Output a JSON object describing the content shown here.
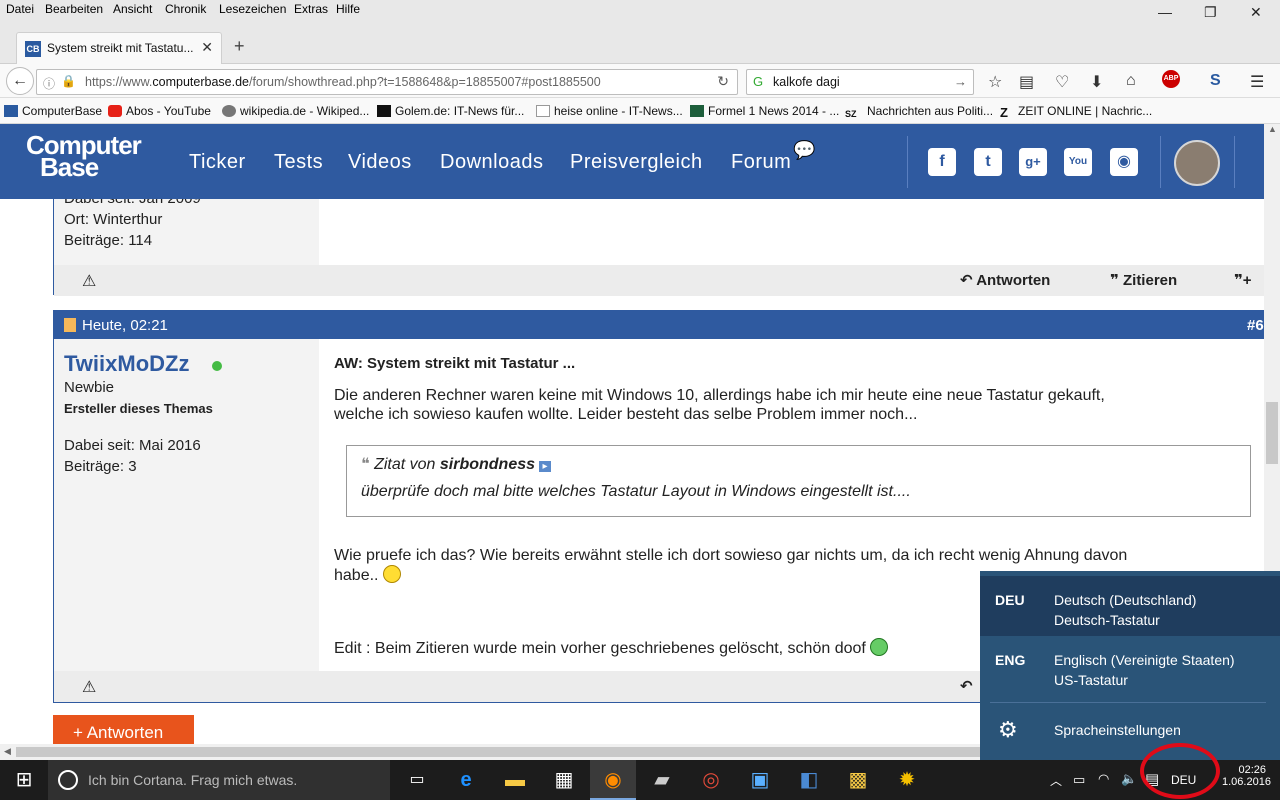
{
  "menu": [
    "Datei",
    "Bearbeiten",
    "Ansicht",
    "Chronik",
    "Lesezeichen",
    "Extras",
    "Hilfe"
  ],
  "window_controls": {
    "minimize": "—",
    "maximize": "❐",
    "close": "✕"
  },
  "tab": {
    "title": "System streikt mit Tastatu...",
    "close": "✕",
    "favicon": "CB"
  },
  "new_tab": "+",
  "address": {
    "prefix": "https://www.",
    "domain": "computerbase.de",
    "path": "/forum/showthread.php?t=1588648&p=18855007#post1885500"
  },
  "search": {
    "value": "kalkofe dagi"
  },
  "bookmarks": [
    "ComputerBase",
    "Abos - YouTube",
    "wikipedia.de - Wikiped...",
    "Golem.de: IT-News für...",
    "heise online - IT-News...",
    "Formel 1 News 2014 - ...",
    "Nachrichten aus Politi...",
    "ZEIT ONLINE | Nachric..."
  ],
  "site": {
    "logo_line1": "Computer",
    "logo_line2": "Base",
    "nav": [
      "Ticker",
      "Tests",
      "Videos",
      "Downloads",
      "Preisvergleich",
      "Forum"
    ]
  },
  "prev_post": {
    "since": "Dabei seit: Jan 2009",
    "location": "Ort: Winterthur",
    "posts": "Beiträge: 114",
    "reply": "Antworten",
    "quote": "Zitieren"
  },
  "post": {
    "date": "Heute, 02:21",
    "number": "#6",
    "username": "TwiixMoDZz",
    "rank": "Newbie",
    "creator": "Ersteller dieses Themas",
    "since": "Dabei seit: Mai 2016",
    "posts": "Beiträge: 3",
    "subject": "AW: System streikt mit Tastatur ...",
    "p1": "Die anderen Rechner waren keine mit Windows 10, allerdings habe ich mir heute eine neue Tastatur gekauft,",
    "p1b": "welche ich sowieso kaufen wollte. Leider besteht das selbe Problem immer noch...",
    "quote_label": "Zitat von",
    "quote_author": "sirbondness",
    "quote_text": "überprüfe doch mal bitte welches Tastatur Layout in Windows eingestellt ist....",
    "p2": "Wie pruefe ich das? Wie bereits erwähnt stelle ich dort sowieso gar nichts um, da ich recht wenig Ahnung davon",
    "p2b": "habe..",
    "p3": "Edit : Beim Zitieren wurde mein vorher geschriebenes gelöscht, schön doof"
  },
  "reply_button": "+ Antworten",
  "language_popup": {
    "items": [
      {
        "code": "DEU",
        "name": "Deutsch (Deutschland)",
        "layout": "Deutsch-Tastatur"
      },
      {
        "code": "ENG",
        "name": "Englisch (Vereinigte Staaten)",
        "layout": "US-Tastatur"
      }
    ],
    "settings": "Spracheinstellungen"
  },
  "taskbar": {
    "cortana": "Ich bin Cortana. Frag mich etwas.",
    "lang": "DEU",
    "time": "02:26",
    "date": "1.06.2016"
  },
  "colors": {
    "brand": "#2f5aa0",
    "reply": "#e8541c",
    "online": "#44bb44",
    "highlight": "#e00b18"
  }
}
